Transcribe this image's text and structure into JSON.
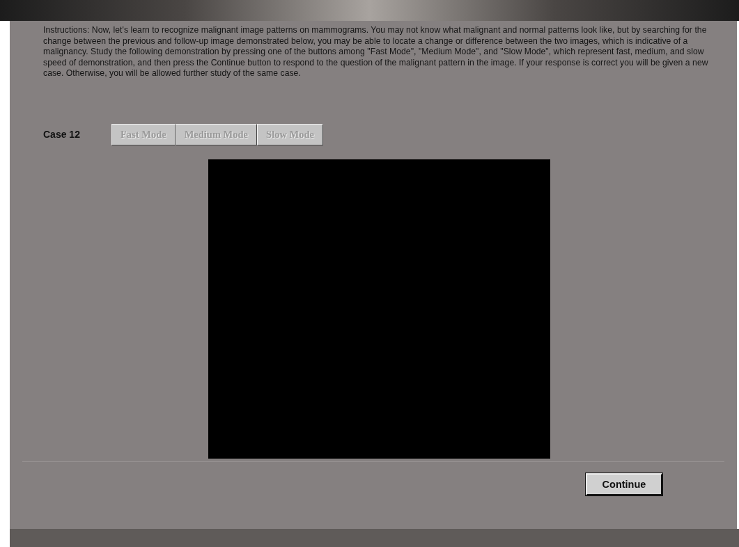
{
  "instructions": "Instructions: Now, let's learn to recognize malignant image patterns on mammograms. You may not know what malignant and normal patterns look like, but by searching for the change between the previous and follow-up image demonstrated below, you may be able to locate a change or difference between the two images, which is indicative of a malignancy.  Study the following demonstration by pressing one of the buttons among \"Fast Mode\", \"Medium Mode\", and \"Slow Mode\", which represent fast, medium, and slow speed of demonstration, and then press the Continue button to respond to the question of the malignant pattern in the image.  If your response is correct you will be given a new case. Otherwise, you will be allowed further study of the same case.",
  "case_label": "Case 12",
  "mode_buttons": [
    {
      "label": "Fast Mode",
      "disabled": true
    },
    {
      "label": "Medium Mode",
      "disabled": true
    },
    {
      "label": "Slow Mode",
      "disabled": true
    }
  ],
  "continue_button": "Continue"
}
